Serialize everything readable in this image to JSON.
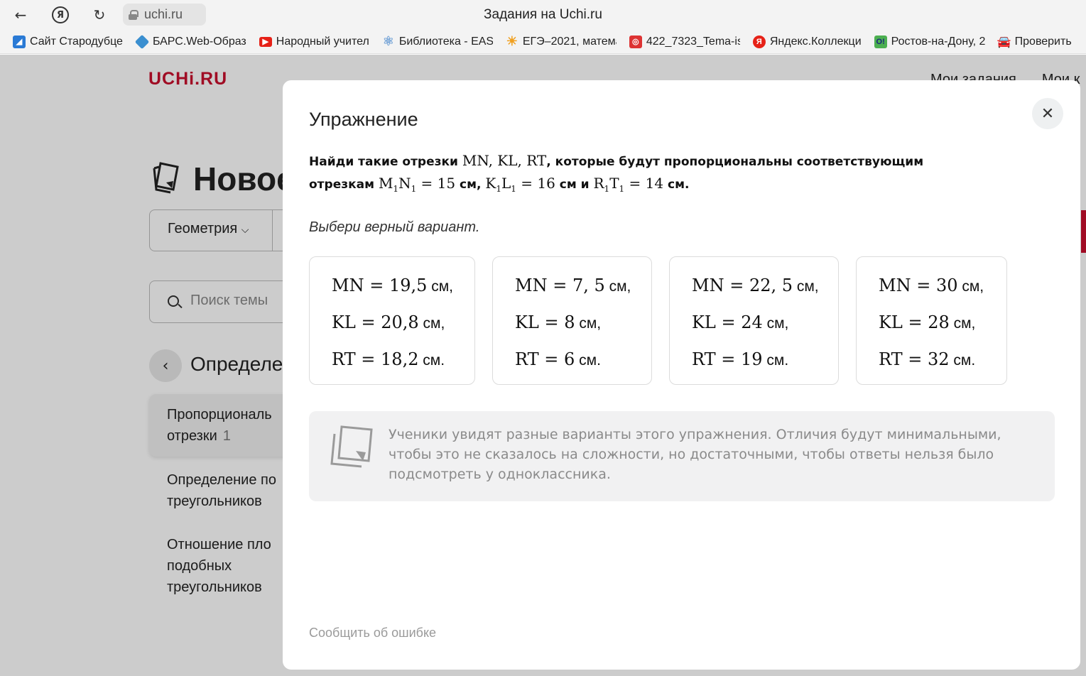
{
  "browser": {
    "url": "uchi.ru",
    "page_title": "Задания на Uchi.ru",
    "bookmarks": [
      {
        "label": "Сайт Стародубце",
        "icon": "site-icon",
        "color": "#2a7ad5"
      },
      {
        "label": "БАРС.Web-Образ",
        "icon": "bars-icon",
        "color": "#3b8fd0"
      },
      {
        "label": "Народный учител",
        "icon": "youtube-icon",
        "color": "#e62117"
      },
      {
        "label": "Библиотека - EAS",
        "icon": "atom-icon",
        "color": "#7aa7d8"
      },
      {
        "label": "ЕГЭ–2021, матема",
        "icon": "sun-icon",
        "color": "#f0a020"
      },
      {
        "label": "422_7323_Tema-is",
        "icon": "pdf-icon",
        "color": "#d33"
      },
      {
        "label": "Яндекс.Коллекци",
        "icon": "yandex-icon",
        "color": "#e62117"
      },
      {
        "label": "Ростов-на-Дону, 2",
        "icon": "ok-icon",
        "color": "#4caf50"
      },
      {
        "label": "Проверить",
        "icon": "car-icon",
        "color": "#f06030"
      }
    ]
  },
  "page": {
    "logo": "UCHi.RU",
    "nav": [
      "Мои задания",
      "Мои к"
    ],
    "title": "Новое",
    "filter": "Геометрия",
    "search_placeholder": "Поиск темы",
    "section": "Определе",
    "items": [
      {
        "text": "Пропорциональ отрезки",
        "count": "1"
      },
      {
        "text": "Определение по треугольников"
      },
      {
        "text": "Отношение пло подобных треугольников"
      }
    ]
  },
  "modal": {
    "title": "Упражнение",
    "task": {
      "p1": "Найди такие отрезки ",
      "p2": ", которые будут пропорциональны соответствующим отрезкам ",
      "p3": " см, ",
      "p4": " см и ",
      "p5": " см."
    },
    "hint": "Выбери верный вариант.",
    "options": [
      {
        "mn": "19,5",
        "kl": "20,8",
        "rt": "18,2"
      },
      {
        "mn": "7, 5",
        "kl": "8",
        "rt": "6"
      },
      {
        "mn": "22, 5",
        "kl": "24",
        "rt": "19"
      },
      {
        "mn": "30",
        "kl": "28",
        "rt": "32"
      }
    ],
    "unit_comma": " см,",
    "unit_dot": " см.",
    "info": "Ученики увидят разные варианты этого упражнения. Отличия будут минимальными, чтобы это не сказалось на сложности, но достаточными, чтобы ответы нельзя было подсмотреть у одноклассника.",
    "report": "Сообщить об ошибке"
  }
}
